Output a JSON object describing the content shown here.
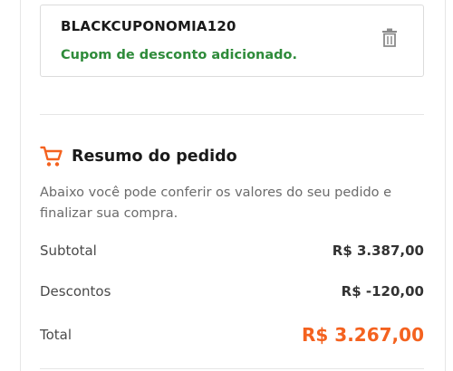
{
  "coupon": {
    "code": "BLACKCUPONOMIA120",
    "status": "Cupom de desconto adicionado.",
    "remove_icon": "trash-icon"
  },
  "summary": {
    "icon": "shopping-cart-icon",
    "title": "Resumo do pedido",
    "description": "Abaixo você pode conferir os valores do seu pedido e finalizar sua compra.",
    "subtotal_label": "Subtotal",
    "subtotal_value": "R$ 3.387,00",
    "discount_label": "Descontos",
    "discount_value": "R$ -120,00",
    "total_label": "Total",
    "total_value": "R$ 3.267,00"
  },
  "colors": {
    "accent_orange": "#f4621f",
    "success_green": "#2e8b3a"
  }
}
